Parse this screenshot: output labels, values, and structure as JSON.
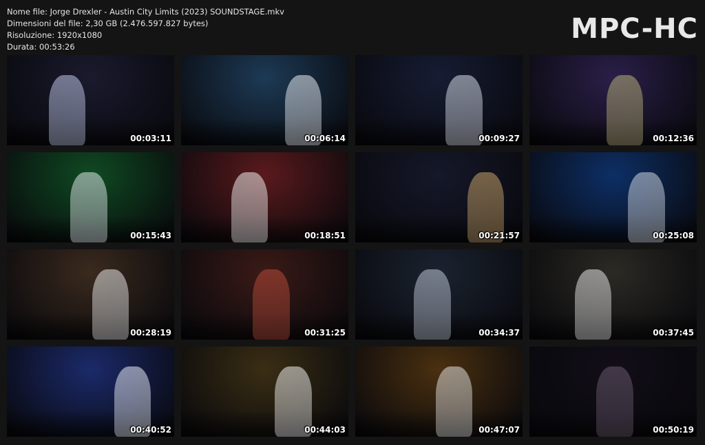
{
  "info": {
    "file_name": "Nome file: Jorge Drexler - Austin City Limits (2023) SOUNDSTAGE.mkv",
    "file_size": "Dimensioni del file: 2,30 GB (2.476.597.827 bytes)",
    "resolution": "Risoluzione: 1920x1080",
    "duration": "Durata: 00:53:26"
  },
  "logo": "MPC-HC",
  "thumbnails": [
    {
      "time": "00:03:11",
      "bg": "#1a1a2e",
      "accent": "#c0c8e8"
    },
    {
      "time": "00:06:14",
      "bg": "#1d3a55",
      "accent": "#e8ecf2"
    },
    {
      "time": "00:09:27",
      "bg": "#161c33",
      "accent": "#d8dde8"
    },
    {
      "time": "00:12:36",
      "bg": "#2a1f48",
      "accent": "#b8b07a"
    },
    {
      "time": "00:15:43",
      "bg": "#0f4a22",
      "accent": "#dfe6ea"
    },
    {
      "time": "00:18:51",
      "bg": "#5a1a1c",
      "accent": "#eeeeee"
    },
    {
      "time": "00:21:57",
      "bg": "#15182a",
      "accent": "#c9a46a"
    },
    {
      "time": "00:25:08",
      "bg": "#0d2f66",
      "accent": "#d0d6e0"
    },
    {
      "time": "00:28:19",
      "bg": "#3a2a1e",
      "accent": "#e8e8e8"
    },
    {
      "time": "00:31:25",
      "bg": "#3a1a16",
      "accent": "#b74a3a"
    },
    {
      "time": "00:34:37",
      "bg": "#1b2330",
      "accent": "#bfc8d6"
    },
    {
      "time": "00:37:45",
      "bg": "#2c2a24",
      "accent": "#e6e6e6"
    },
    {
      "time": "00:40:52",
      "bg": "#1b2a6a",
      "accent": "#e8ecf6"
    },
    {
      "time": "00:44:03",
      "bg": "#3a2e14",
      "accent": "#efefef"
    },
    {
      "time": "00:47:07",
      "bg": "#4a3010",
      "accent": "#e0e0e0"
    },
    {
      "time": "00:50:19",
      "bg": "#120e18",
      "accent": "#6a5a6e"
    }
  ]
}
